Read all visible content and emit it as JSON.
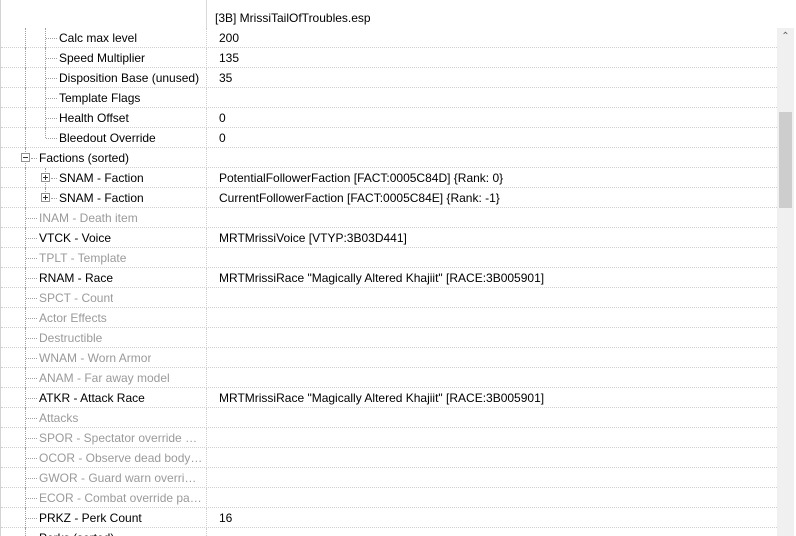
{
  "header": {
    "title": "[3B] MrissiTailOfTroubles.esp"
  },
  "rows": [
    {
      "label": "Calc max level",
      "value": "200",
      "level": 1,
      "dim": false
    },
    {
      "label": "Speed Multiplier",
      "value": "135",
      "level": 1,
      "dim": false
    },
    {
      "label": "Disposition Base (unused)",
      "value": "35",
      "level": 1,
      "dim": false
    },
    {
      "label": "Template Flags",
      "value": "",
      "level": 1,
      "dim": false
    },
    {
      "label": "Health Offset",
      "value": "0",
      "level": 1,
      "dim": false
    },
    {
      "label": "Bleedout Override",
      "value": "0",
      "level": 1,
      "dim": false
    },
    {
      "label": "Factions (sorted)",
      "value": "",
      "level": 0,
      "dim": false,
      "expander": "minus"
    },
    {
      "label": "SNAM - Faction",
      "value": "PotentialFollowerFaction [FACT:0005C84D] {Rank: 0}",
      "level": 1,
      "dim": false,
      "expander": "plus"
    },
    {
      "label": "SNAM - Faction",
      "value": "CurrentFollowerFaction [FACT:0005C84E] {Rank: -1}",
      "level": 1,
      "dim": false,
      "expander": "plus"
    },
    {
      "label": "INAM - Death item",
      "value": "",
      "level": 0,
      "dim": true
    },
    {
      "label": "VTCK - Voice",
      "value": "MRTMrissiVoice [VTYP:3B03D441]",
      "level": 0,
      "dim": false
    },
    {
      "label": "TPLT - Template",
      "value": "",
      "level": 0,
      "dim": true
    },
    {
      "label": "RNAM - Race",
      "value": "MRTMrissiRace \"Magically Altered Khajiit\" [RACE:3B005901]",
      "level": 0,
      "dim": false
    },
    {
      "label": "SPCT - Count",
      "value": "",
      "level": 0,
      "dim": true
    },
    {
      "label": "Actor Effects",
      "value": "",
      "level": 0,
      "dim": true
    },
    {
      "label": "Destructible",
      "value": "",
      "level": 0,
      "dim": true
    },
    {
      "label": "WNAM - Worn Armor",
      "value": "",
      "level": 0,
      "dim": true
    },
    {
      "label": "ANAM - Far away model",
      "value": "",
      "level": 0,
      "dim": true
    },
    {
      "label": "ATKR - Attack Race",
      "value": "MRTMrissiRace \"Magically Altered Khajiit\" [RACE:3B005901]",
      "level": 0,
      "dim": false
    },
    {
      "label": "Attacks",
      "value": "",
      "level": 0,
      "dim": true
    },
    {
      "label": "SPOR - Spectator override pa...",
      "value": "",
      "level": 0,
      "dim": true
    },
    {
      "label": "OCOR - Observe dead body ...",
      "value": "",
      "level": 0,
      "dim": true
    },
    {
      "label": "GWOR - Guard warn override...",
      "value": "",
      "level": 0,
      "dim": true
    },
    {
      "label": "ECOR - Combat override pac...",
      "value": "",
      "level": 0,
      "dim": true
    },
    {
      "label": "PRKZ - Perk Count",
      "value": "16",
      "level": 0,
      "dim": false
    },
    {
      "label": "Perks (sorted)",
      "value": "",
      "level": 0,
      "dim": false
    }
  ],
  "icons": {
    "scroll_up": "scroll-up-arrow-icon"
  }
}
